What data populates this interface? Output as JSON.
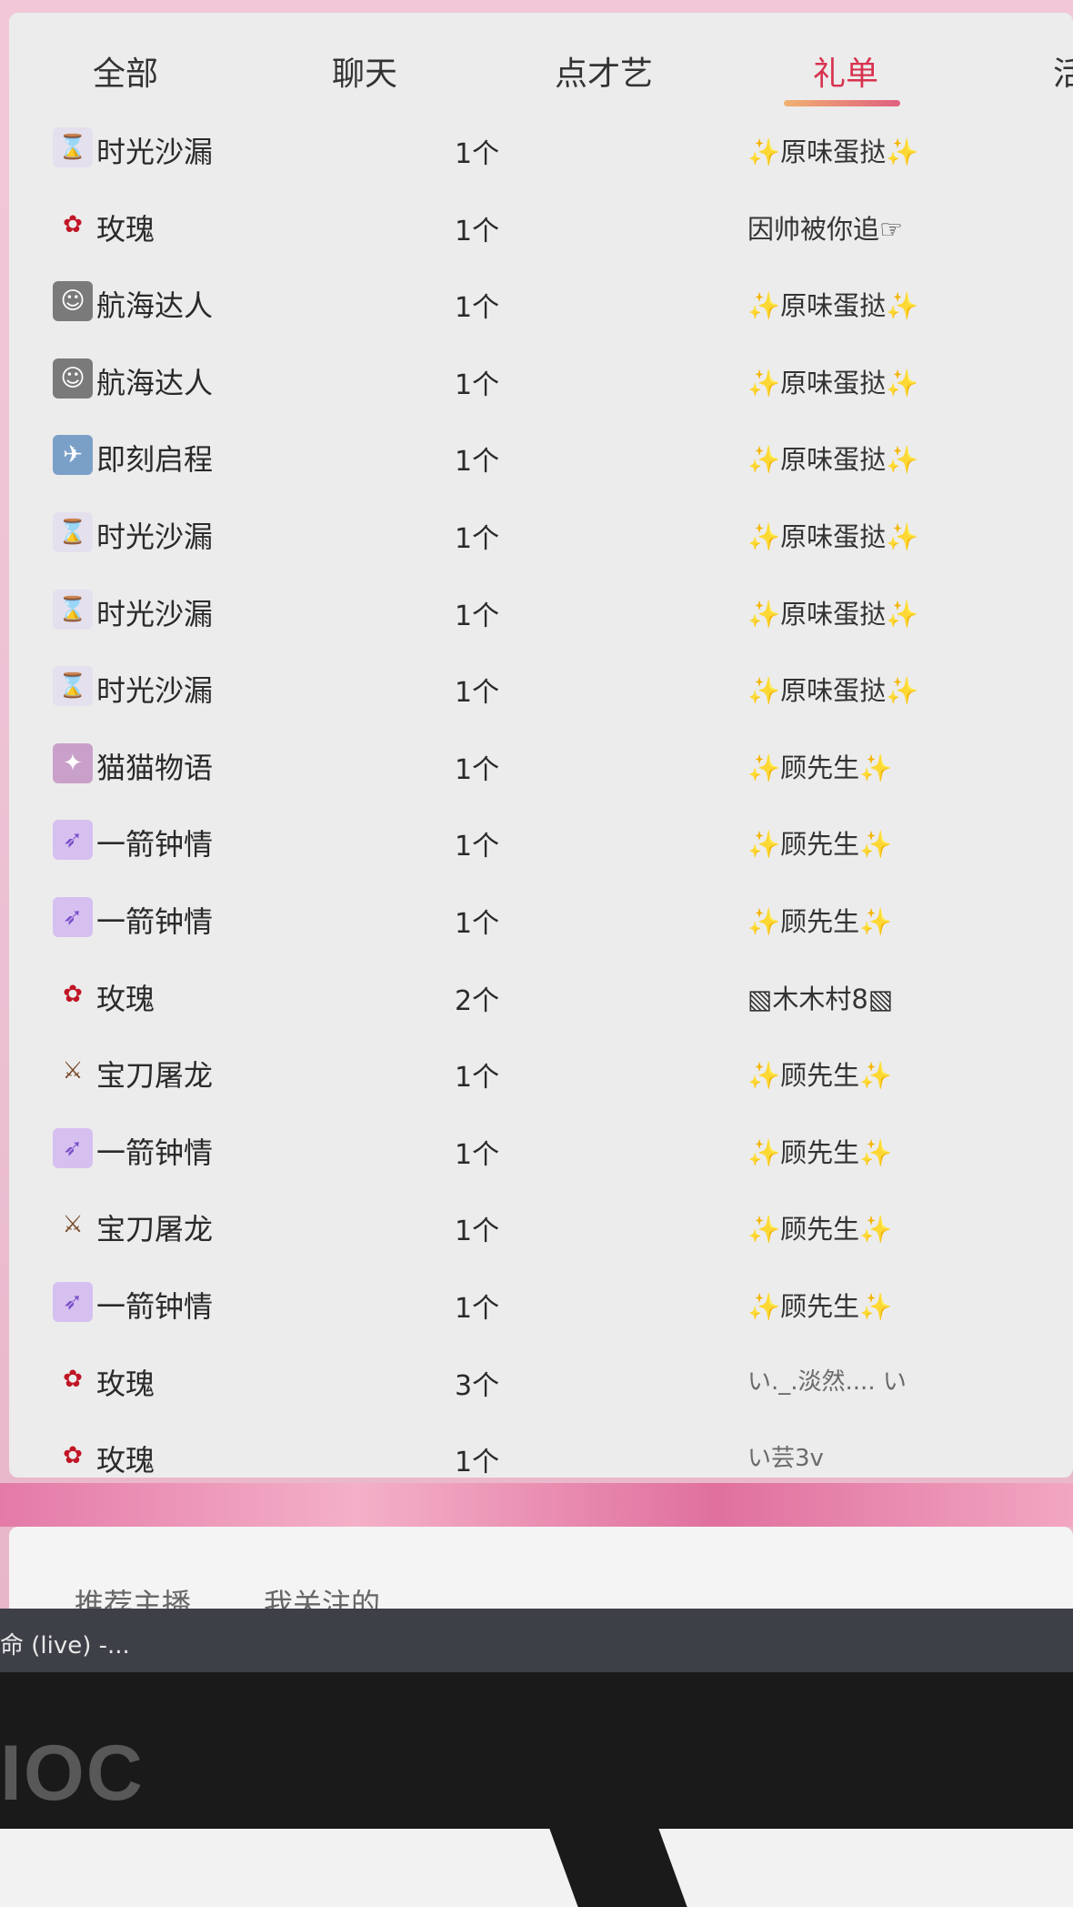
{
  "tabs": [
    {
      "label": "全部",
      "active": false
    },
    {
      "label": "聊天",
      "active": false
    },
    {
      "label": "点才艺",
      "active": false
    },
    {
      "label": "礼单",
      "active": true
    },
    {
      "label": "活",
      "active": false
    }
  ],
  "gift_rows": [
    {
      "gift": "时光沙漏",
      "icon": "hourglass-icon",
      "count": "1个",
      "sender": "✨原味蛋挞✨"
    },
    {
      "gift": "玫瑰",
      "icon": "rose-icon",
      "count": "1个",
      "sender": "因帅被你追☞"
    },
    {
      "gift": "航海达人",
      "icon": "sailor-icon",
      "count": "1个",
      "sender": "✨原味蛋挞✨"
    },
    {
      "gift": "航海达人",
      "icon": "sailor-icon",
      "count": "1个",
      "sender": "✨原味蛋挞✨"
    },
    {
      "gift": "即刻启程",
      "icon": "journey-icon",
      "count": "1个",
      "sender": "✨原味蛋挞✨"
    },
    {
      "gift": "时光沙漏",
      "icon": "hourglass-icon",
      "count": "1个",
      "sender": "✨原味蛋挞✨"
    },
    {
      "gift": "时光沙漏",
      "icon": "hourglass-icon",
      "count": "1个",
      "sender": "✨原味蛋挞✨"
    },
    {
      "gift": "时光沙漏",
      "icon": "hourglass-icon",
      "count": "1个",
      "sender": "✨原味蛋挞✨"
    },
    {
      "gift": "猫猫物语",
      "icon": "cat-icon",
      "count": "1个",
      "sender": "✨顾先生✨"
    },
    {
      "gift": "一箭钟情",
      "icon": "arrow-icon",
      "count": "1个",
      "sender": "✨顾先生✨"
    },
    {
      "gift": "一箭钟情",
      "icon": "arrow-icon",
      "count": "1个",
      "sender": "✨顾先生✨"
    },
    {
      "gift": "玫瑰",
      "icon": "rose-icon",
      "count": "2个",
      "sender": "▧木木村8▧"
    },
    {
      "gift": "宝刀屠龙",
      "icon": "sword-icon",
      "count": "1个",
      "sender": "✨顾先生✨"
    },
    {
      "gift": "一箭钟情",
      "icon": "arrow-icon",
      "count": "1个",
      "sender": "✨顾先生✨"
    },
    {
      "gift": "宝刀屠龙",
      "icon": "sword-icon",
      "count": "1个",
      "sender": "✨顾先生✨"
    },
    {
      "gift": "一箭钟情",
      "icon": "arrow-icon",
      "count": "1个",
      "sender": "✨顾先生✨"
    },
    {
      "gift": "玫瑰",
      "icon": "rose-icon",
      "count": "3个",
      "sender": "い._.淡然.... い"
    },
    {
      "gift": "玫瑰",
      "icon": "rose-icon",
      "count": "1个",
      "sender": "い芸3v"
    }
  ],
  "lower_tabs": [
    "推荐主播",
    "我关注的"
  ],
  "taskbar_text": "命 (live) -...",
  "monitor_brand": "IOC"
}
